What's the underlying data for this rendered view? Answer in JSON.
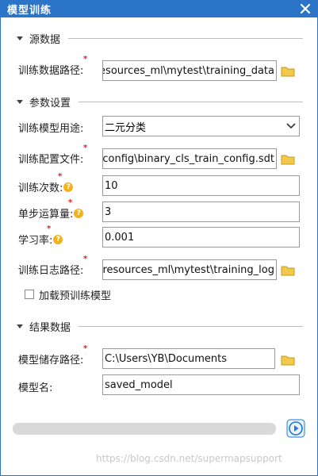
{
  "window": {
    "title": "模型训练",
    "close_icon": "close-icon"
  },
  "sections": {
    "source": "源数据",
    "params": "参数设置",
    "result": "结果数据"
  },
  "source": {
    "train_data_path": {
      "label": "训练数据路径:",
      "value": "\\resources_ml\\mytest\\training_data"
    }
  },
  "params": {
    "model_usage": {
      "label": "训练模型用途:",
      "value": "二元分类"
    },
    "config_file": {
      "label": "训练配置文件:",
      "value": "r_config\\binary_cls_train_config.sdt"
    },
    "epochs": {
      "label": "训练次数:",
      "value": "10"
    },
    "batch_size": {
      "label": "单步运算量:",
      "value": "3"
    },
    "learning_rate": {
      "label": "学习率:",
      "value": "0.001"
    },
    "log_path": {
      "label": "训练日志路径:",
      "value": "s\\resources_ml\\mytest\\training_log"
    },
    "pretrained": {
      "label": "加载预训练模型",
      "checked": false
    }
  },
  "result": {
    "model_save_path": {
      "label": "模型储存路径:",
      "value": "C:\\Users\\YB\\Documents"
    },
    "model_name": {
      "label": "模型名:",
      "value": "saved_model"
    }
  },
  "progress": {
    "value": 0
  },
  "watermark": "https://blog.csdn.net/supermapsupport",
  "colors": {
    "titlebar": "#2b74c7",
    "required": "#e02020",
    "help": "#f2b220",
    "folder": "#f2c94c",
    "run_button": "#1a7ad4"
  }
}
